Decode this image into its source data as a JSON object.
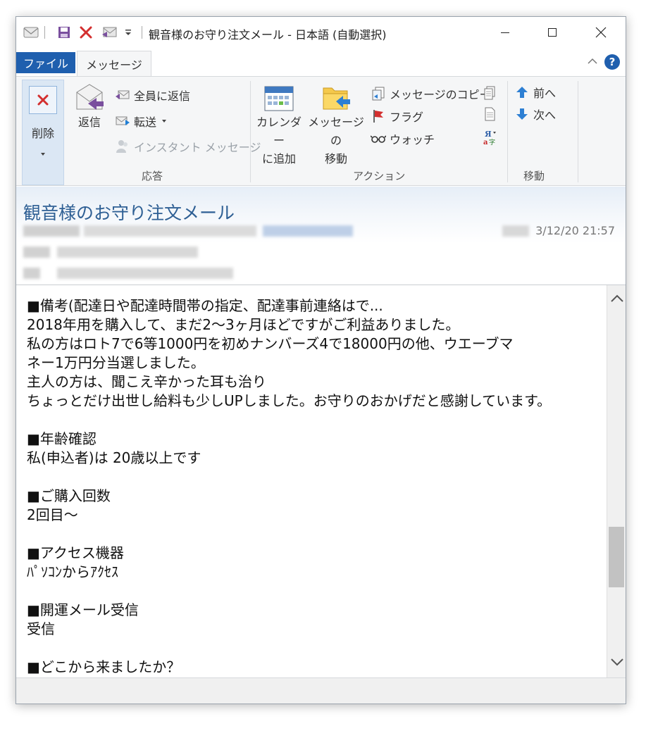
{
  "window": {
    "title": "観音様のお守り注文メール - 日本語 (自動選択)"
  },
  "ribbon_tabs": {
    "file": "ファイル",
    "message": "メッセージ"
  },
  "ribbon": {
    "delete": "削除",
    "reply": "返信",
    "reply_all": "全員に返信",
    "forward": "転送",
    "instant_message": "インスタント メッセージ",
    "group_respond": "応答",
    "add_to_calendar_line1": "カレンダー",
    "add_to_calendar_line2": "に追加",
    "move_message_line1": "メッセージの",
    "move_message_line2": "移動",
    "copy_message": "メッセージのコピー",
    "flag": "フラグ",
    "watch": "ウォッチ",
    "group_actions": "アクション",
    "previous": "前へ",
    "next": "次へ",
    "group_navigate": "移動"
  },
  "header": {
    "subject": "観音様のお守り注文メール",
    "date_partial": "3/12/20 21:57"
  },
  "message_lines": [
    "■備考(配達日や配達時間帯の指定、配達事前連絡はで...",
    "2018年用を購入して、まだ2～3ヶ月ほどですがご利益ありました。",
    "私の方はロト7で6等1000円を初めナンバーズ4で18000円の他、ウエーブマ",
    "ネー1万円分当選しました。",
    "主人の方は、聞こえ辛かった耳も治り",
    "ちょっとだけ出世し給料も少しUPしました。お守りのおかげだと感謝しています。",
    "",
    "■年齢確認",
    "私(申込者)は 20歳以上です",
    "",
    "■ご購入回数",
    "2回目～",
    "",
    "■アクセス機器",
    "ﾊﾟｿｺﾝからｱｸｾｽ",
    "",
    "■開運メール受信",
    "受信",
    "",
    "■どこから来ましたか？"
  ],
  "colors": {
    "file_tab": "#1f5fae",
    "subject": "#2e5f94",
    "ribbon_bg": "#f5f6f7"
  }
}
